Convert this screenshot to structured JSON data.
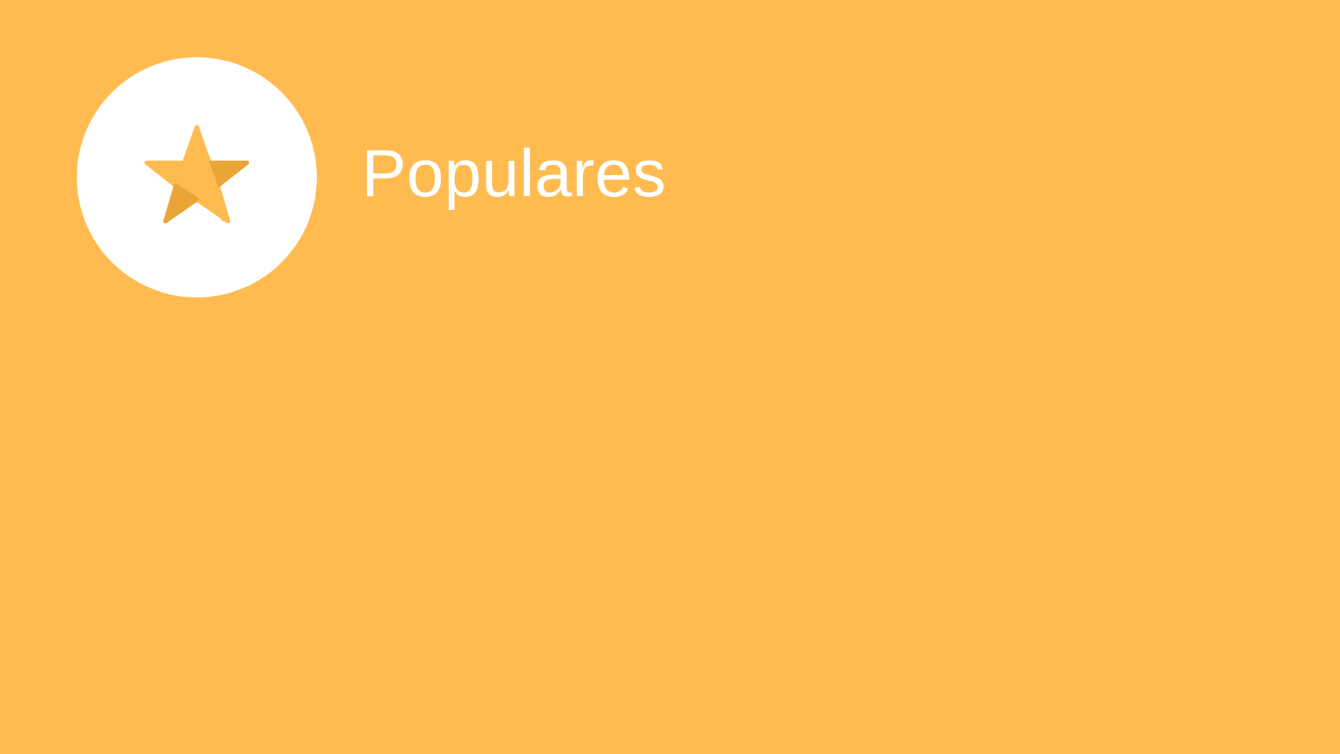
{
  "category": {
    "title": "Populares",
    "icon": "star-icon"
  },
  "colors": {
    "background": "#FFBB50",
    "circle": "#FFFFFF",
    "star_light": "#FFBB50",
    "star_dark": "#E9A535",
    "title": "#FFFFFF"
  }
}
